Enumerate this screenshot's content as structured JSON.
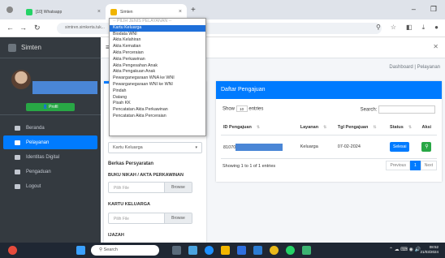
{
  "browser": {
    "tabs": [
      {
        "label": "[10] Whatsapp"
      },
      {
        "label": "Simten"
      }
    ],
    "address": "simtren.simkerta.tuk..."
  },
  "sidebar": {
    "brand": "Simten",
    "profile_button": "Profil",
    "items": [
      {
        "label": "Beranda"
      },
      {
        "label": "Pelayanan"
      },
      {
        "label": "Identitas Digital"
      },
      {
        "label": "Pengaduan"
      },
      {
        "label": "Logout"
      }
    ]
  },
  "breadcrumb": "Dashboard | Pelayanan",
  "dropdown": {
    "items": [
      "-- PILIH JENIS PELAYANAN --",
      "Kartu Keluarga",
      "Biodata WNI",
      "Akta Kelahiran",
      "Akta Kematian",
      "Akta Perceraian",
      "Akta Perkawinan",
      "Akta Pengesahan Anak",
      "Akta Pengakuan Anak",
      "Pewarganegaraan WNA ke WNI",
      "Pewarganegaraan WNI ke WNI",
      "Pindah",
      "Datang",
      "Pisah KK",
      "Pencatatan Akta Perkawinan",
      "Pencatatan Akta Perceraian"
    ],
    "selected_index": 1
  },
  "form": {
    "select_value": "Kartu Keluarga",
    "berkas_title": "Berkas Persyaratan",
    "files": [
      {
        "label": "BUKU NIKAH / AKTA PERKAWINAN",
        "placeholder": "Pilih File",
        "browse": "Browse"
      },
      {
        "label": "KARTU KELUARGA",
        "placeholder": "Pilih File",
        "browse": "Browse"
      }
    ],
    "next_label": "IJAZAH"
  },
  "table_card": {
    "title": "Daftar Pengajuan",
    "show_prefix": "Show",
    "show_value": "10",
    "show_suffix": "entries",
    "search_label": "Search:",
    "columns": [
      "ID Pengajuan",
      "Layanan",
      "Tgl Pengajuan",
      "Status",
      "Aksi"
    ],
    "rows": [
      {
        "id": "81070",
        "layanan": "Keluarga",
        "tgl": "07-02-2024",
        "status": "Selesai"
      }
    ],
    "info": "Showing 1 to 1 of 1 entries",
    "pager": {
      "prev": "Previous",
      "current": "1",
      "next": "Next"
    }
  },
  "taskbar": {
    "search_placeholder": "Search",
    "time": "08:52",
    "date": "21/03/2024"
  }
}
